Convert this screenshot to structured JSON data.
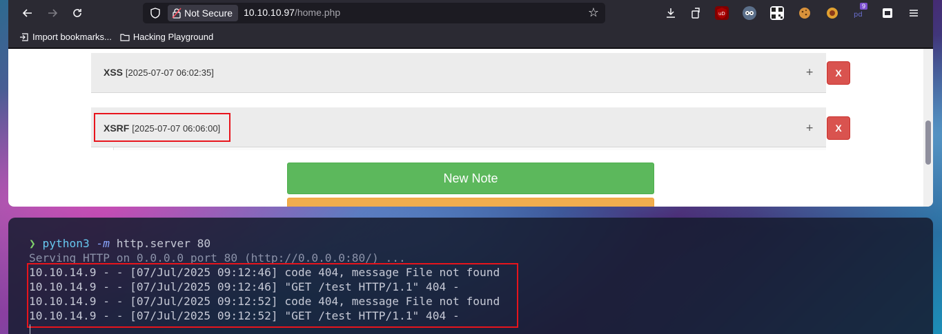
{
  "browser": {
    "url_security_label": "Not Secure",
    "url_host": "10.10.10.97",
    "url_path": "/home.php",
    "extension_badge": "9",
    "bookmarks": [
      {
        "label": "Import bookmarks..."
      },
      {
        "label": "Hacking Playground"
      }
    ]
  },
  "notes": [
    {
      "title": "XSS",
      "date": "[2025-07-07 06:02:35]",
      "expand": "+",
      "delete_label": "X"
    },
    {
      "title": "XSRF",
      "date": "[2025-07-07 06:06:00]",
      "expand": "+",
      "delete_label": "X"
    }
  ],
  "actions": {
    "new_note_label": "New Note"
  },
  "terminal": {
    "prompt_symbol": "❯",
    "command": "python3",
    "flag": "-m",
    "args": "http.server 80",
    "lines": [
      "Serving HTTP on 0.0.0.0 port 80 (http://0.0.0.0:80/) ...",
      "10.10.14.9 - - [07/Jul/2025 09:12:46] code 404, message File not found",
      "10.10.14.9 - - [07/Jul/2025 09:12:46] \"GET /test HTTP/1.1\" 404 -",
      "10.10.14.9 - - [07/Jul/2025 09:12:52] code 404, message File not found",
      "10.10.14.9 - - [07/Jul/2025 09:12:52] \"GET /test HTTP/1.1\" 404 -"
    ]
  },
  "colors": {
    "success": "#5cb85c",
    "danger": "#d9534f",
    "warning": "#f0ad4e",
    "highlight": "#e8141c"
  },
  "icons": {
    "toolbar": [
      "back-arrow-icon",
      "forward-arrow-icon",
      "reload-icon",
      "shield-icon",
      "lock-warning-icon",
      "bookmark-star-icon",
      "downloads-icon",
      "share-icon",
      "ublock-icon",
      "extension-icon",
      "qr-icon",
      "cookie-icon",
      "extension-icon",
      "calendar-icon",
      "menu-icon"
    ]
  }
}
